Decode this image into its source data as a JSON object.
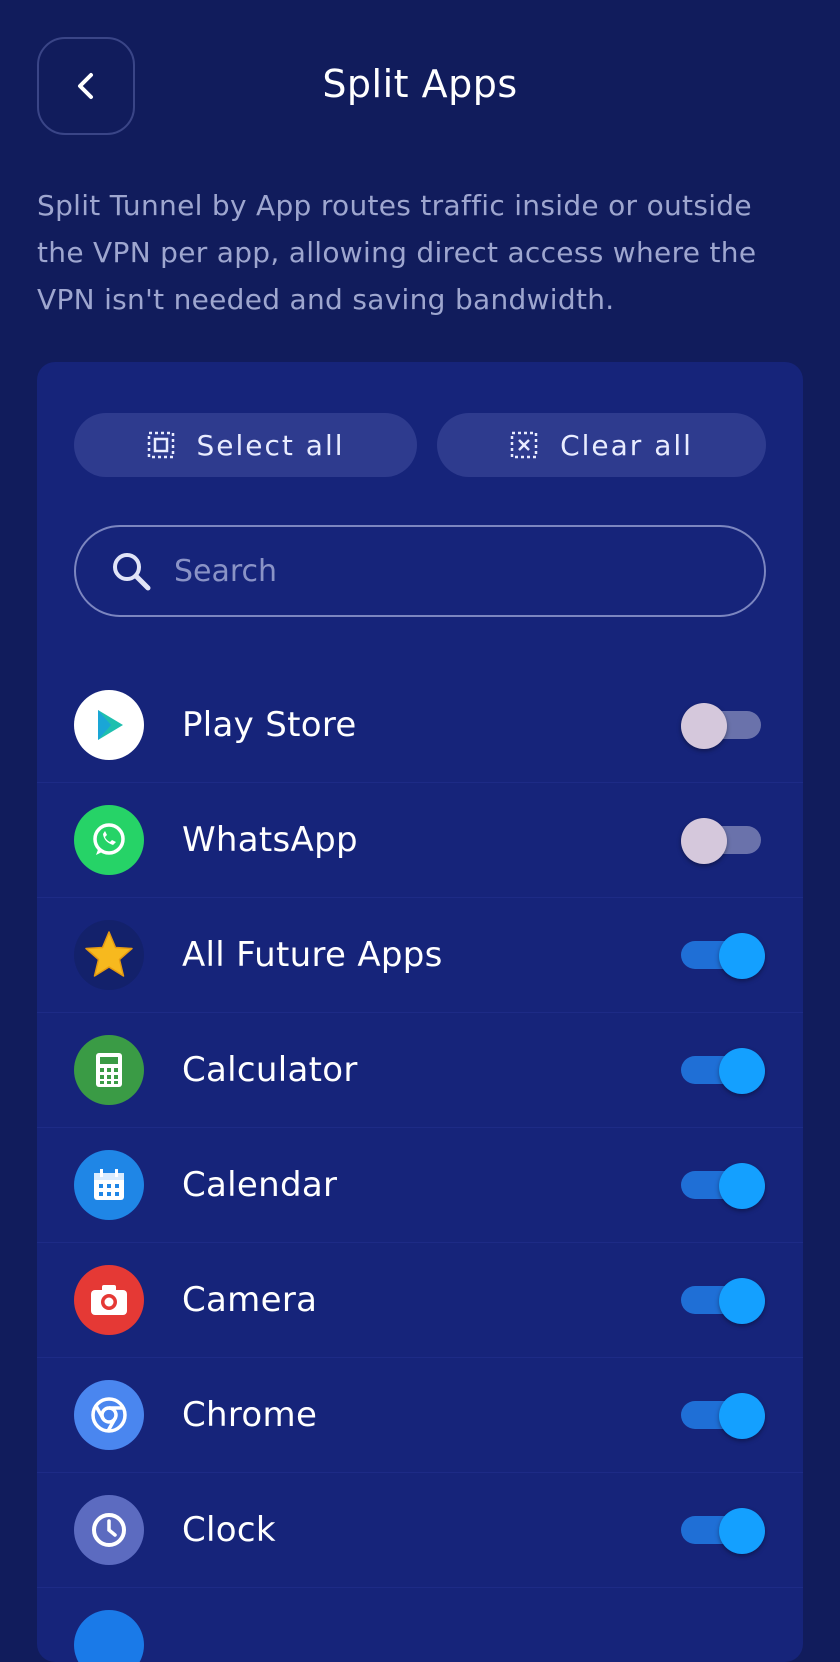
{
  "header": {
    "title": "Split Apps"
  },
  "description": "Split Tunnel by App routes traffic inside or outside the VPN per app, allowing direct access where the VPN isn't needed and saving bandwidth.",
  "actions": {
    "select_all": "Select all",
    "clear_all": "Clear all"
  },
  "search": {
    "placeholder": "Search"
  },
  "apps": [
    {
      "name": "Play Store",
      "icon": "play-store-icon",
      "enabled": false
    },
    {
      "name": "WhatsApp",
      "icon": "whatsapp-icon",
      "enabled": false
    },
    {
      "name": "All Future Apps",
      "icon": "star-icon",
      "enabled": true
    },
    {
      "name": "Calculator",
      "icon": "calculator-icon",
      "enabled": true
    },
    {
      "name": "Calendar",
      "icon": "calendar-icon",
      "enabled": true
    },
    {
      "name": "Camera",
      "icon": "camera-icon",
      "enabled": true
    },
    {
      "name": "Chrome",
      "icon": "chrome-icon",
      "enabled": true
    },
    {
      "name": "Clock",
      "icon": "clock-icon",
      "enabled": true
    }
  ],
  "colors": {
    "background": "#111c5c",
    "panel": "#16247a",
    "toggle_on": "#14a0ff",
    "toggle_off": "#d5c8dc"
  }
}
